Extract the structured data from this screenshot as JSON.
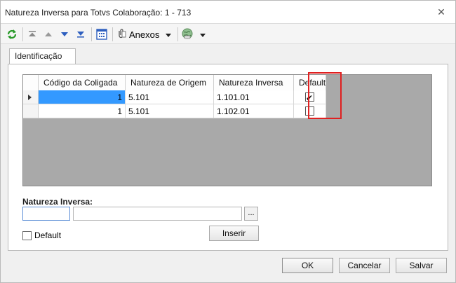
{
  "window": {
    "title": "Natureza Inversa para Totvs Colaboração: 1 - 713",
    "close_glyph": "✕"
  },
  "toolbar": {
    "items": [
      {
        "icon": "refresh-icon"
      },
      {
        "icon": "first-record-icon"
      },
      {
        "icon": "previous-record-icon"
      },
      {
        "icon": "next-record-icon"
      },
      {
        "icon": "last-record-icon"
      },
      {
        "icon": "grid-view-icon"
      },
      {
        "icon": "attachment-icon"
      },
      {
        "icon": "globe-icon"
      }
    ],
    "attachments_label": "Anexos"
  },
  "tabs": [
    {
      "label": "Identificação",
      "active": true
    }
  ],
  "grid": {
    "columns": [
      "Código da Coligada",
      "Natureza de Origem",
      "Natureza Inversa",
      "Default"
    ],
    "rows": [
      {
        "coligada": "1",
        "origem": "5.101",
        "inversa": "1.101.01",
        "default": true,
        "current": true
      },
      {
        "coligada": "1",
        "origem": "5.101",
        "inversa": "1.102.01",
        "default": false,
        "current": false
      }
    ]
  },
  "form": {
    "label": "Natureza Inversa:",
    "code_value": "",
    "description_value": "",
    "lookup_button": "...",
    "default_label": "Default",
    "default_checked": false,
    "insert_button": "Inserir"
  },
  "footer": {
    "ok": "OK",
    "cancel": "Cancelar",
    "save": "Salvar"
  },
  "colors": {
    "highlight": "#e02020",
    "selection": "#3399ff",
    "grid_background": "#a9a9a9"
  }
}
